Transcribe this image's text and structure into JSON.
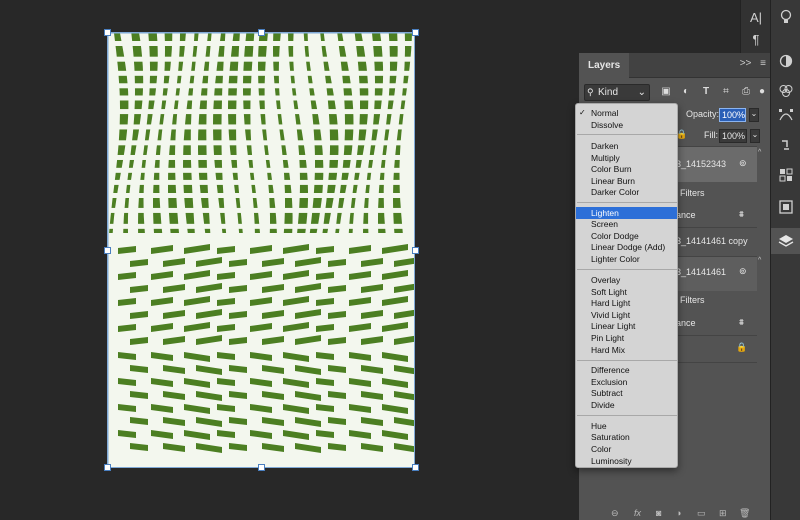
{
  "layers_panel": {
    "tab_label": "Layers",
    "collapse_label": ">>",
    "kind_label": "Kind",
    "opacity_label": "Opacity:",
    "opacity_value": "100%",
    "fill_label": "Fill:",
    "fill_value": "100%",
    "layers": [
      {
        "name": "3_14152343"
      },
      {
        "name": "Filters"
      },
      {
        "name": "ance"
      },
      {
        "name": "3_14141461 copy"
      },
      {
        "name": "3_14141461"
      },
      {
        "name": "Filters"
      },
      {
        "name": "ance"
      }
    ]
  },
  "blend_menu": {
    "selected": "Normal",
    "highlighted": "Lighten",
    "groups": [
      [
        "Normal",
        "Dissolve"
      ],
      [
        "Darken",
        "Multiply",
        "Color Burn",
        "Linear Burn",
        "Darker Color"
      ],
      [
        "Lighten",
        "Screen",
        "Color Dodge",
        "Linear Dodge (Add)",
        "Lighter Color"
      ],
      [
        "Overlay",
        "Soft Light",
        "Hard Light",
        "Vivid Light",
        "Linear Light",
        "Pin Light",
        "Hard Mix"
      ],
      [
        "Difference",
        "Exclusion",
        "Subtract",
        "Divide"
      ],
      [
        "Hue",
        "Saturation",
        "Color",
        "Luminosity"
      ]
    ]
  },
  "colors": {
    "app_bg": "#282828",
    "panel_bg": "#535353",
    "highlight": "#2c6fd8",
    "pattern_green": "#4c7f22"
  },
  "tools_strip1": [
    "text-character-icon",
    "paragraph-icon"
  ],
  "tools_strip2": [
    "lightbulb-icon",
    "adjustments-icon",
    "channels-icon",
    "paths-icon",
    "history-icon",
    "properties-icon",
    "swatches-icon",
    "layers-icon"
  ]
}
